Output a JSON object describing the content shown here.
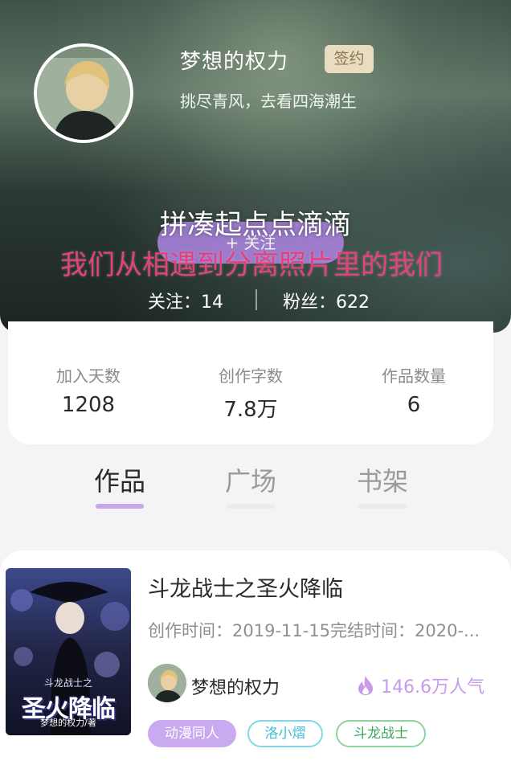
{
  "profile": {
    "nickname": "梦想的权力",
    "sign_badge": "签约",
    "bio": "挑尽青风，去看四海潮生",
    "follow_button": "+ 关注",
    "overlay_line1": "拼凑起点点滴滴",
    "overlay_line2": "我们从相遇到分离照片里的我们",
    "follows_text": "关注：14",
    "fans_text": "粉丝：622"
  },
  "stats": [
    {
      "label": "加入天数",
      "value": "1208"
    },
    {
      "label": "创作字数",
      "value": "7.8万"
    },
    {
      "label": "作品数量",
      "value": "6"
    }
  ],
  "tabs": [
    {
      "label": "作品",
      "active": true
    },
    {
      "label": "广场",
      "active": false
    },
    {
      "label": "书架",
      "active": false
    }
  ],
  "work": {
    "title": "斗龙战士之圣火降临",
    "time": "创作时间：2019-11-15完结时间：2020-...",
    "author": "梦想的权力",
    "popularity": "146.6万人气",
    "cover_title": "圣火降临",
    "cover_top": "斗龙战士之",
    "cover_sub": "梦想的权力/著",
    "tags": [
      "动漫同人",
      "洛小熠",
      "斗龙战士"
    ]
  },
  "colors": {
    "accent_purple": "#c9a9ef",
    "tag_cyan": "#3bbfd4",
    "tag_green": "#3ea65a",
    "overlay_pink": "#e5417a"
  },
  "icons": {
    "popularity": "flame-icon"
  }
}
